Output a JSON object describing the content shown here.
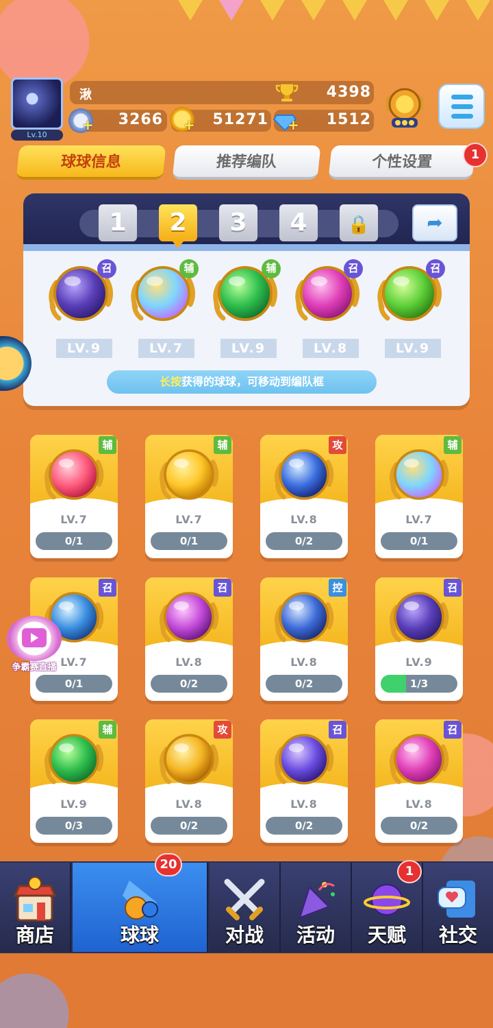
{
  "player": {
    "name": "湫",
    "level_label": "Lv.10",
    "trophies": "4398",
    "resource_a": "3266",
    "coins": "51271",
    "gems": "1512",
    "plus": "+"
  },
  "tabs": [
    {
      "label": "球球信息",
      "active": true
    },
    {
      "label": "推荐编队",
      "active": false
    },
    {
      "label": "个性设置",
      "active": false,
      "badge": "1"
    }
  ],
  "team_slots": [
    "1",
    "2",
    "3",
    "4"
  ],
  "active_slot": "2",
  "team_balls": [
    {
      "level": "LV.9",
      "tag": "召",
      "icon": "ghost-ball-icon"
    },
    {
      "level": "LV.7",
      "tag": "辅",
      "icon": "rainbow-ball-icon"
    },
    {
      "level": "LV.9",
      "tag": "辅",
      "icon": "green-arrow-ball-icon"
    },
    {
      "level": "LV.8",
      "tag": "召",
      "icon": "pink-sword-ball-icon"
    },
    {
      "level": "LV.9",
      "tag": "召",
      "icon": "green-star-ball-icon"
    }
  ],
  "hint": {
    "highlight": "长按",
    "text": "获得的球球，可移动到编队框"
  },
  "cards": [
    {
      "level": "LV.7",
      "progress": "0/1",
      "fill": 0,
      "tag": "辅",
      "icon": "gift-ball-icon"
    },
    {
      "level": "LV.7",
      "progress": "0/1",
      "fill": 0,
      "tag": "辅",
      "icon": "piggy-ball-icon"
    },
    {
      "level": "LV.8",
      "progress": "0/2",
      "fill": 0,
      "tag": "攻",
      "icon": "vortex-ball-icon"
    },
    {
      "level": "LV.7",
      "progress": "0/1",
      "fill": 0,
      "tag": "辅",
      "icon": "rainbow-ball-icon"
    },
    {
      "level": "LV.7",
      "progress": "0/1",
      "fill": 0,
      "tag": "召",
      "icon": "whirlwind-ball-icon"
    },
    {
      "level": "LV.8",
      "progress": "0/2",
      "fill": 0,
      "tag": "召",
      "icon": "mushroom-cloud-ball-icon"
    },
    {
      "level": "LV.8",
      "progress": "0/2",
      "fill": 0,
      "tag": "控",
      "icon": "clock-ball-icon"
    },
    {
      "level": "LV.9",
      "progress": "1/3",
      "fill": 0.33,
      "tag": "召",
      "icon": "ghost-ball-icon"
    },
    {
      "level": "LV.9",
      "progress": "0/3",
      "fill": 0,
      "tag": "辅",
      "icon": "green-arrow-ball-icon"
    },
    {
      "level": "LV.8",
      "progress": "0/2",
      "fill": 0,
      "tag": "攻",
      "icon": "gold-blade-ball-icon"
    },
    {
      "level": "LV.8",
      "progress": "0/2",
      "fill": 0,
      "tag": "召",
      "icon": "orbit-ball-icon"
    },
    {
      "level": "LV.8",
      "progress": "0/2",
      "fill": 0,
      "tag": "召",
      "icon": "pink-sword-ball-icon"
    }
  ],
  "live": {
    "label": "争霸赛直播"
  },
  "nav": [
    {
      "label": "商店",
      "icon": "shop-icon"
    },
    {
      "label": "球球",
      "icon": "balls-icon",
      "active": true,
      "badge": "20"
    },
    {
      "label": "对战",
      "icon": "crossed-swords-icon"
    },
    {
      "label": "活动",
      "icon": "party-popper-icon"
    },
    {
      "label": "天赋",
      "icon": "planet-icon",
      "badge": "1"
    },
    {
      "label": "社交",
      "icon": "chat-heart-icon"
    }
  ],
  "colors": {
    "accent": "#f6b81c",
    "nav_active": "#1f63d0",
    "badge": "#e63131",
    "progress_fill": "#3fd16b"
  }
}
